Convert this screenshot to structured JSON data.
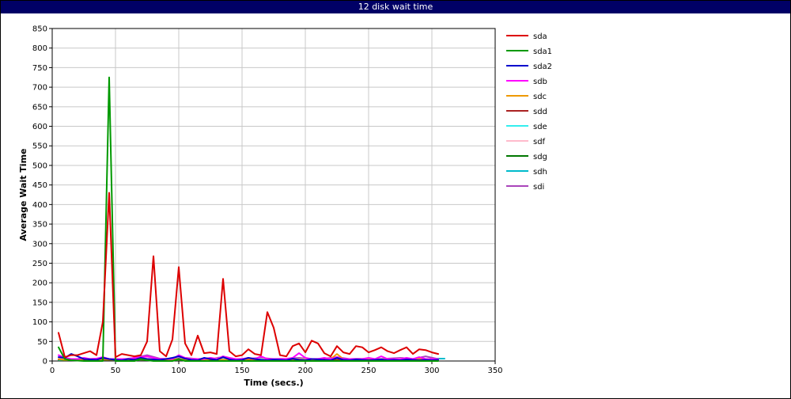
{
  "window": {
    "title": "12 disk wait time"
  },
  "chart_data": {
    "type": "line",
    "title": "12 disk wait time",
    "xlabel": "Time (secs.)",
    "ylabel": "Average Wait Time",
    "xlim": [
      0,
      350
    ],
    "ylim": [
      0,
      850
    ],
    "xticks": [
      0,
      50,
      100,
      150,
      200,
      250,
      300,
      350
    ],
    "yticks": [
      0,
      50,
      100,
      150,
      200,
      250,
      300,
      350,
      400,
      450,
      500,
      550,
      600,
      650,
      700,
      750,
      800,
      850
    ],
    "grid": true,
    "legend_position": "right",
    "series": [
      {
        "name": "sda",
        "color": "#dd0000",
        "x": [
          5,
          10,
          15,
          20,
          25,
          30,
          35,
          40,
          45,
          50,
          55,
          60,
          65,
          70,
          75,
          80,
          85,
          90,
          95,
          100,
          105,
          110,
          115,
          120,
          125,
          130,
          135,
          140,
          145,
          150,
          155,
          160,
          165,
          170,
          175,
          180,
          185,
          190,
          195,
          200,
          205,
          210,
          215,
          220,
          225,
          230,
          235,
          240,
          245,
          250,
          255,
          260,
          265,
          270,
          275,
          280,
          285,
          290,
          295,
          300,
          305
        ],
        "y": [
          72,
          10,
          15,
          15,
          20,
          25,
          15,
          100,
          430,
          10,
          18,
          15,
          12,
          15,
          50,
          268,
          25,
          12,
          55,
          240,
          45,
          15,
          65,
          20,
          22,
          18,
          210,
          25,
          12,
          15,
          30,
          18,
          15,
          125,
          85,
          15,
          12,
          38,
          45,
          22,
          52,
          45,
          20,
          12,
          38,
          22,
          18,
          38,
          35,
          22,
          28,
          35,
          25,
          20,
          28,
          35,
          18,
          30,
          28,
          22,
          18
        ]
      },
      {
        "name": "sda1",
        "color": "#009900",
        "x": [
          5,
          10,
          15,
          20,
          25,
          30,
          35,
          40,
          45,
          50,
          55,
          60,
          65,
          70,
          75,
          80,
          85,
          90,
          95,
          100,
          105,
          110,
          115,
          120,
          125,
          130,
          135,
          140,
          145,
          150,
          155,
          160,
          165,
          170,
          175,
          180,
          185,
          190,
          195,
          200,
          205,
          210,
          215,
          220,
          225,
          230,
          235,
          240,
          245,
          250,
          255,
          260,
          265,
          270,
          275,
          280,
          285,
          290,
          295,
          300,
          305
        ],
        "y": [
          35,
          5,
          2,
          1,
          0,
          0,
          0,
          0,
          725,
          0,
          0,
          0,
          0,
          5,
          2,
          0,
          0,
          0,
          0,
          5,
          0,
          0,
          0,
          0,
          0,
          0,
          0,
          0,
          0,
          0,
          0,
          0,
          0,
          0,
          0,
          0,
          0,
          0,
          0,
          0,
          0,
          0,
          0,
          0,
          0,
          0,
          0,
          0,
          0,
          0,
          0,
          0,
          0,
          0,
          0,
          0,
          0,
          0,
          0,
          0,
          0
        ]
      },
      {
        "name": "sda2",
        "color": "#0000cc",
        "x": [
          5,
          10,
          15,
          20,
          25,
          30,
          35,
          40,
          45,
          50,
          55,
          60,
          65,
          70,
          75,
          80,
          85,
          90,
          95,
          100,
          105,
          110,
          115,
          120,
          125,
          130,
          135,
          140,
          145,
          150,
          155,
          160,
          165,
          170,
          175,
          180,
          185,
          190,
          195,
          200,
          205,
          210,
          215,
          220,
          225,
          230,
          235,
          240,
          245,
          250,
          255,
          260,
          265,
          270,
          275,
          280,
          285,
          290,
          295,
          300,
          305
        ],
        "y": [
          10,
          8,
          18,
          12,
          5,
          4,
          3,
          8,
          5,
          3,
          2,
          5,
          3,
          8,
          5,
          4,
          3,
          5,
          8,
          12,
          6,
          3,
          2,
          8,
          5,
          3,
          10,
          4,
          2,
          3,
          8,
          5,
          3,
          2,
          4,
          3,
          2,
          6,
          3,
          2,
          5,
          4,
          3,
          2,
          8,
          3,
          2,
          4,
          3,
          2,
          3,
          4,
          2,
          3,
          2,
          4,
          3,
          2,
          3,
          2,
          3
        ]
      },
      {
        "name": "sdb",
        "color": "#ff00ff",
        "x": [
          5,
          10,
          15,
          20,
          25,
          30,
          35,
          40,
          45,
          50,
          55,
          60,
          65,
          70,
          75,
          80,
          85,
          90,
          95,
          100,
          105,
          110,
          115,
          120,
          125,
          130,
          135,
          140,
          145,
          150,
          155,
          160,
          165,
          170,
          175,
          180,
          185,
          190,
          195,
          200,
          205,
          210,
          215,
          220,
          225,
          230,
          235,
          240,
          245,
          250,
          255,
          260,
          265,
          270,
          275,
          280,
          285,
          290,
          295,
          300,
          305
        ],
        "y": [
          15,
          8,
          5,
          5,
          8,
          5,
          6,
          10,
          5,
          5,
          5,
          5,
          8,
          10,
          12,
          8,
          5,
          5,
          5,
          15,
          8,
          5,
          5,
          5,
          8,
          5,
          12,
          8,
          5,
          5,
          8,
          5,
          12,
          5,
          5,
          5,
          5,
          8,
          20,
          8,
          5,
          5,
          8,
          5,
          10,
          5,
          5,
          5,
          5,
          8,
          5,
          12,
          5,
          5,
          5,
          8,
          5,
          10,
          5,
          5,
          5
        ]
      },
      {
        "name": "sdc",
        "color": "#ee9900",
        "x": [
          5,
          10,
          15,
          20,
          25,
          30,
          35,
          40,
          45,
          50,
          55,
          60,
          65,
          70,
          75,
          80,
          85,
          90,
          95,
          100,
          105,
          110,
          115,
          120,
          125,
          130,
          135,
          140,
          145,
          150,
          155,
          160,
          165,
          170,
          175,
          180,
          185,
          190,
          195,
          200,
          205,
          210,
          215,
          220,
          225,
          230,
          235,
          240,
          245,
          250,
          255,
          260,
          265,
          270,
          275,
          280,
          285,
          290,
          295,
          300,
          305
        ],
        "y": [
          5,
          3,
          3,
          4,
          5,
          3,
          3,
          5,
          4,
          3,
          3,
          4,
          3,
          5,
          4,
          3,
          3,
          4,
          3,
          5,
          3,
          3,
          4,
          3,
          5,
          4,
          3,
          3,
          4,
          3,
          5,
          4,
          3,
          3,
          4,
          3,
          3,
          5,
          4,
          3,
          3,
          4,
          3,
          5,
          18,
          5,
          3,
          3,
          4,
          3,
          5,
          4,
          3,
          3,
          4,
          3,
          3,
          5,
          4,
          3,
          3
        ]
      },
      {
        "name": "sdd",
        "color": "#aa2222",
        "x": [
          5,
          15,
          25,
          35,
          45,
          55,
          65,
          75,
          85,
          95,
          105,
          115,
          125,
          135,
          145,
          155,
          165,
          175,
          185,
          195,
          205,
          215,
          225,
          235,
          245,
          255,
          265,
          275,
          285,
          295,
          305
        ],
        "y": [
          4,
          3,
          3,
          4,
          3,
          3,
          4,
          3,
          3,
          4,
          3,
          3,
          4,
          3,
          3,
          4,
          3,
          3,
          4,
          3,
          3,
          4,
          3,
          3,
          4,
          3,
          3,
          4,
          3,
          3,
          4
        ]
      },
      {
        "name": "sde",
        "color": "#33eeee",
        "x": [
          5,
          15,
          25,
          35,
          45,
          55,
          65,
          75,
          85,
          95,
          105,
          115,
          125,
          135,
          145,
          155,
          165,
          175,
          185,
          195,
          205,
          215,
          225,
          235,
          245,
          255,
          265,
          275,
          285,
          295,
          305
        ],
        "y": [
          3,
          4,
          3,
          3,
          4,
          3,
          3,
          4,
          3,
          3,
          4,
          3,
          3,
          4,
          3,
          3,
          4,
          3,
          3,
          4,
          3,
          3,
          4,
          3,
          3,
          4,
          3,
          3,
          4,
          3,
          3
        ]
      },
      {
        "name": "sdf",
        "color": "#ffbbcc",
        "x": [
          5,
          15,
          25,
          35,
          45,
          55,
          65,
          75,
          85,
          95,
          105,
          115,
          125,
          135,
          145,
          155,
          165,
          175,
          185,
          195,
          205,
          215,
          225,
          235,
          245,
          255,
          265,
          275,
          285,
          295,
          305
        ],
        "y": [
          5,
          4,
          6,
          5,
          4,
          5,
          6,
          8,
          5,
          4,
          6,
          5,
          8,
          5,
          4,
          6,
          5,
          4,
          6,
          5,
          4,
          6,
          5,
          4,
          6,
          5,
          4,
          6,
          5,
          4,
          5
        ]
      },
      {
        "name": "sdg",
        "color": "#007700",
        "x": [
          5,
          15,
          25,
          35,
          45,
          55,
          65,
          75,
          85,
          95,
          105,
          115,
          125,
          135,
          145,
          155,
          165,
          175,
          185,
          195,
          205,
          215,
          225,
          235,
          245,
          255,
          265,
          275,
          285,
          295,
          305
        ],
        "y": [
          2,
          2,
          2,
          2,
          2,
          2,
          2,
          2,
          2,
          2,
          2,
          2,
          2,
          2,
          2,
          2,
          2,
          2,
          2,
          2,
          2,
          2,
          2,
          2,
          2,
          2,
          2,
          2,
          2,
          2,
          2
        ]
      },
      {
        "name": "sdh",
        "color": "#00bbcc",
        "x": [
          5,
          15,
          25,
          35,
          45,
          55,
          65,
          75,
          85,
          95,
          105,
          115,
          125,
          135,
          145,
          155,
          165,
          175,
          185,
          195,
          205,
          215,
          225,
          235,
          245,
          255,
          265,
          275,
          285,
          295,
          305,
          310
        ],
        "y": [
          3,
          2,
          3,
          2,
          3,
          2,
          3,
          2,
          3,
          2,
          3,
          2,
          3,
          2,
          3,
          2,
          3,
          2,
          3,
          2,
          3,
          2,
          3,
          2,
          3,
          2,
          3,
          2,
          3,
          2,
          6,
          6
        ]
      },
      {
        "name": "sdi",
        "color": "#aa44bb",
        "x": [
          5,
          15,
          25,
          35,
          45,
          55,
          65,
          75,
          85,
          95,
          105,
          115,
          125,
          135,
          145,
          155,
          165,
          175,
          185,
          195,
          205,
          215,
          225,
          235,
          245,
          255,
          265,
          275,
          285,
          295,
          305
        ],
        "y": [
          3,
          5,
          4,
          6,
          5,
          4,
          8,
          15,
          6,
          5,
          8,
          5,
          6,
          10,
          5,
          6,
          8,
          5,
          6,
          8,
          5,
          6,
          10,
          5,
          6,
          5,
          6,
          8,
          5,
          12,
          5
        ]
      }
    ]
  }
}
